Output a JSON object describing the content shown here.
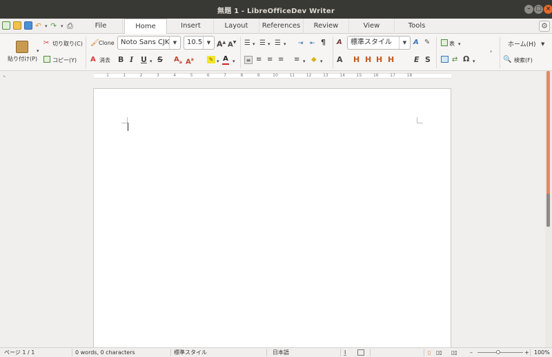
{
  "window": {
    "title": "無題 1 - LibreOfficeDev Writer",
    "controls": [
      "minimize-icon",
      "maximize-icon",
      "close-icon"
    ]
  },
  "tabs": [
    {
      "label": "File",
      "active": false
    },
    {
      "label": "Home",
      "active": true
    },
    {
      "label": "Insert",
      "active": false
    },
    {
      "label": "Layout",
      "active": false
    },
    {
      "label": "References",
      "active": false
    },
    {
      "label": "Review",
      "active": false
    },
    {
      "label": "View",
      "active": false
    },
    {
      "label": "Tools",
      "active": false
    }
  ],
  "quick_access": [
    "new-document-icon",
    "open-folder-icon",
    "save-icon",
    "undo-icon",
    "redo-icon",
    "print-icon"
  ],
  "clipboard": {
    "paste_label": "貼り付け(P)",
    "cut_label": "切り取り(C)",
    "copy_label": "コピー(Y)",
    "clone_label": "Clone",
    "clear_label": "消去"
  },
  "font": {
    "name": "Noto Sans CJK",
    "size": "10.5"
  },
  "format_buttons": [
    "B",
    "I",
    "U",
    "S"
  ],
  "paragraph_style": "標準スタイル",
  "style_buttons": [
    "A",
    "H",
    "H",
    "H",
    "H"
  ],
  "emphasis_buttons": [
    "E",
    "S"
  ],
  "insert_group": {
    "table_label": "表"
  },
  "home_menu": {
    "label": "ホーム(H)",
    "find_label": "検索(F)"
  },
  "ruler": {
    "numbers": [
      "1",
      "1",
      "2",
      "3",
      "4",
      "5",
      "6",
      "7",
      "8",
      "9",
      "10",
      "11",
      "12",
      "13",
      "14",
      "15",
      "16",
      "17",
      "18"
    ]
  },
  "status": {
    "page": "ページ 1 / 1",
    "words": "0 words, 0 characters",
    "style": "標準スタイル",
    "language": "日本語",
    "zoom": "100%"
  },
  "colors": {
    "titlebar": "#383834",
    "close_button": "#e9682a",
    "accent_scroll": "#e9875f",
    "highlight": "#f5e42c",
    "font_color": "#d42020"
  }
}
